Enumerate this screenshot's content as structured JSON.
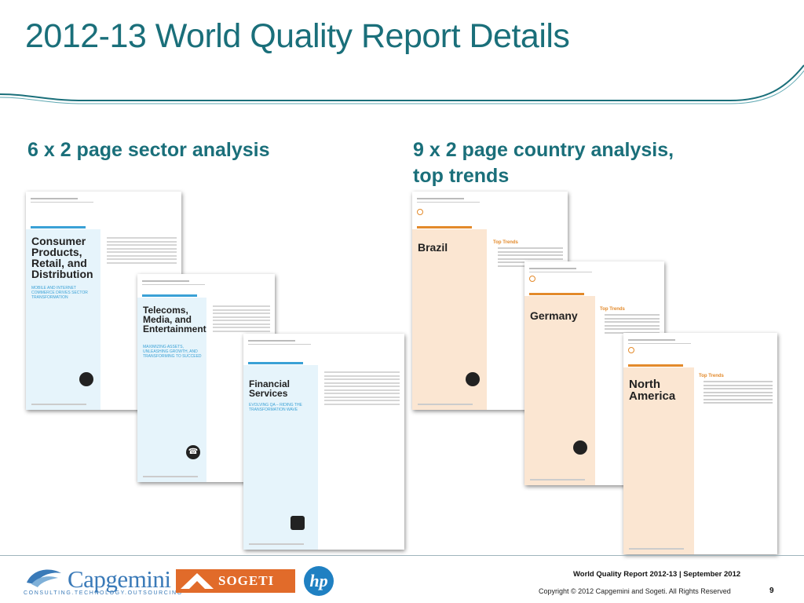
{
  "slide": {
    "title": "2012-13 World Quality Report Details",
    "sector_heading": "6 x 2 page sector analysis",
    "country_heading_line1": "9 x 2 page country analysis,",
    "country_heading_line2": "top trends"
  },
  "sector_pages": [
    {
      "title": "Consumer Products, Retail, and Distribution",
      "tagline": "MOBILE AND INTERNET COMMERCE DRIVES SECTOR TRANSFORMATION"
    },
    {
      "title": "Telecoms, Media, and Entertainment",
      "tagline": "MAXIMIZING ASSETS, UNLEASHING GROWTH, AND TRANSFORMING TO SUCCEED"
    },
    {
      "title": "Financial Services",
      "tagline": "EVOLVING QA – RIDING THE TRANSFORMATION WAVE"
    }
  ],
  "country_pages": [
    {
      "title": "Brazil",
      "trends_label": "Top Trends"
    },
    {
      "title": "Germany",
      "trends_label": "Top Trends"
    },
    {
      "title": "North America",
      "trends_label": "Top Trends"
    }
  ],
  "footer": {
    "report": "World Quality Report 2012-13 | September 2012",
    "copyright": "Copyright © 2012 Capgemini and Sogeti. All Rights Reserved",
    "page_number": "9"
  },
  "logos": {
    "capgemini": "Capgemini",
    "capgemini_tagline": "CONSULTING.TECHNOLOGY.OUTSOURCING",
    "sogeti": "SOGETI",
    "hp": "hp"
  },
  "colors": {
    "title": "#1a6f7a",
    "sector_accent": "#3aa1d6",
    "country_accent": "#e38a2b"
  }
}
